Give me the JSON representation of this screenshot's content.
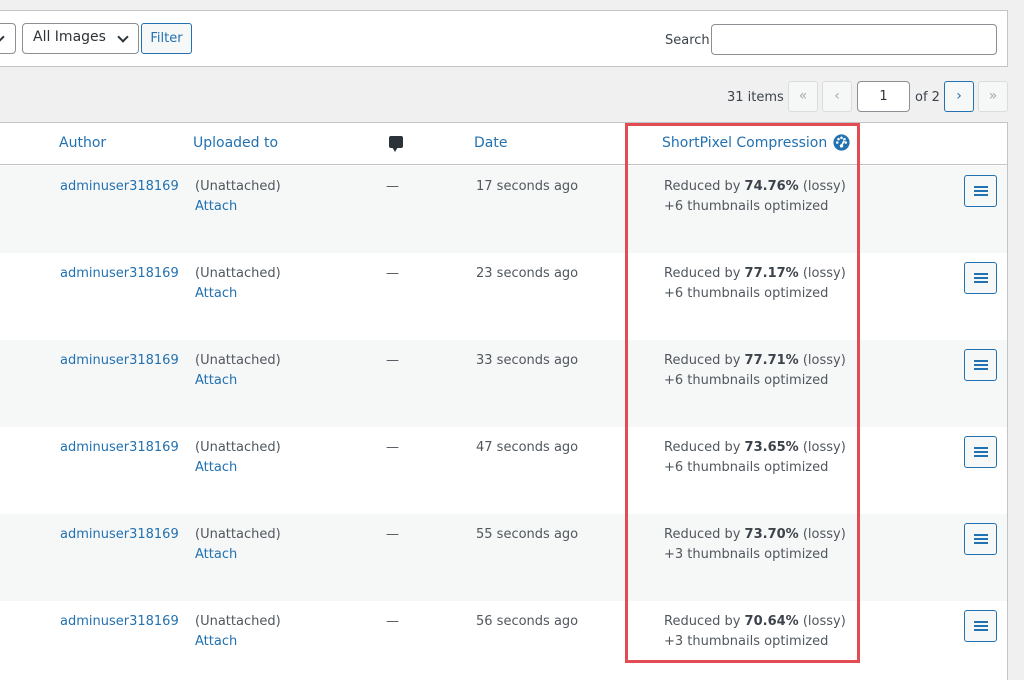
{
  "toolbar": {
    "filter_select_value": "All Images",
    "filter_button": "Filter",
    "search_label": "Search",
    "search_value": ""
  },
  "pagination": {
    "items_count": "31 items",
    "first": "«",
    "prev": "‹",
    "current_page": "1",
    "of_label": "of 2",
    "next": "›",
    "last": "»"
  },
  "columns": {
    "author": "Author",
    "uploaded_to": "Uploaded to",
    "comments_icon": "comment-icon",
    "date": "Date",
    "shortpixel": "ShortPixel Compression",
    "shortpixel_icon": "gauge-icon"
  },
  "rows": [
    {
      "author": "adminuser318169",
      "uploaded": "(Unattached)",
      "attach": "Attach",
      "comments": "—",
      "date": "17 seconds ago",
      "reduced_prefix": "Reduced by ",
      "reduced_pct": "74.76%",
      "reduced_suffix": " (lossy)",
      "thumbs": "+6 thumbnails optimized"
    },
    {
      "author": "adminuser318169",
      "uploaded": "(Unattached)",
      "attach": "Attach",
      "comments": "—",
      "date": "23 seconds ago",
      "reduced_prefix": "Reduced by ",
      "reduced_pct": "77.17%",
      "reduced_suffix": " (lossy)",
      "thumbs": "+6 thumbnails optimized"
    },
    {
      "author": "adminuser318169",
      "uploaded": "(Unattached)",
      "attach": "Attach",
      "comments": "—",
      "date": "33 seconds ago",
      "reduced_prefix": "Reduced by ",
      "reduced_pct": "77.71%",
      "reduced_suffix": " (lossy)",
      "thumbs": "+6 thumbnails optimized"
    },
    {
      "author": "adminuser318169",
      "uploaded": "(Unattached)",
      "attach": "Attach",
      "comments": "—",
      "date": "47 seconds ago",
      "reduced_prefix": "Reduced by ",
      "reduced_pct": "73.65%",
      "reduced_suffix": " (lossy)",
      "thumbs": "+6 thumbnails optimized"
    },
    {
      "author": "adminuser318169",
      "uploaded": "(Unattached)",
      "attach": "Attach",
      "comments": "—",
      "date": "55 seconds ago",
      "reduced_prefix": "Reduced by ",
      "reduced_pct": "73.70%",
      "reduced_suffix": " (lossy)",
      "thumbs": "+3 thumbnails optimized"
    },
    {
      "author": "adminuser318169",
      "uploaded": "(Unattached)",
      "attach": "Attach",
      "comments": "—",
      "date": "56 seconds ago",
      "reduced_prefix": "Reduced by ",
      "reduced_pct": "70.64%",
      "reduced_suffix": " (lossy)",
      "thumbs": "+3 thumbnails optimized"
    }
  ],
  "colors": {
    "link": "#2271b1",
    "highlight": "#e14d52",
    "alt_row": "#f6f7f7"
  }
}
